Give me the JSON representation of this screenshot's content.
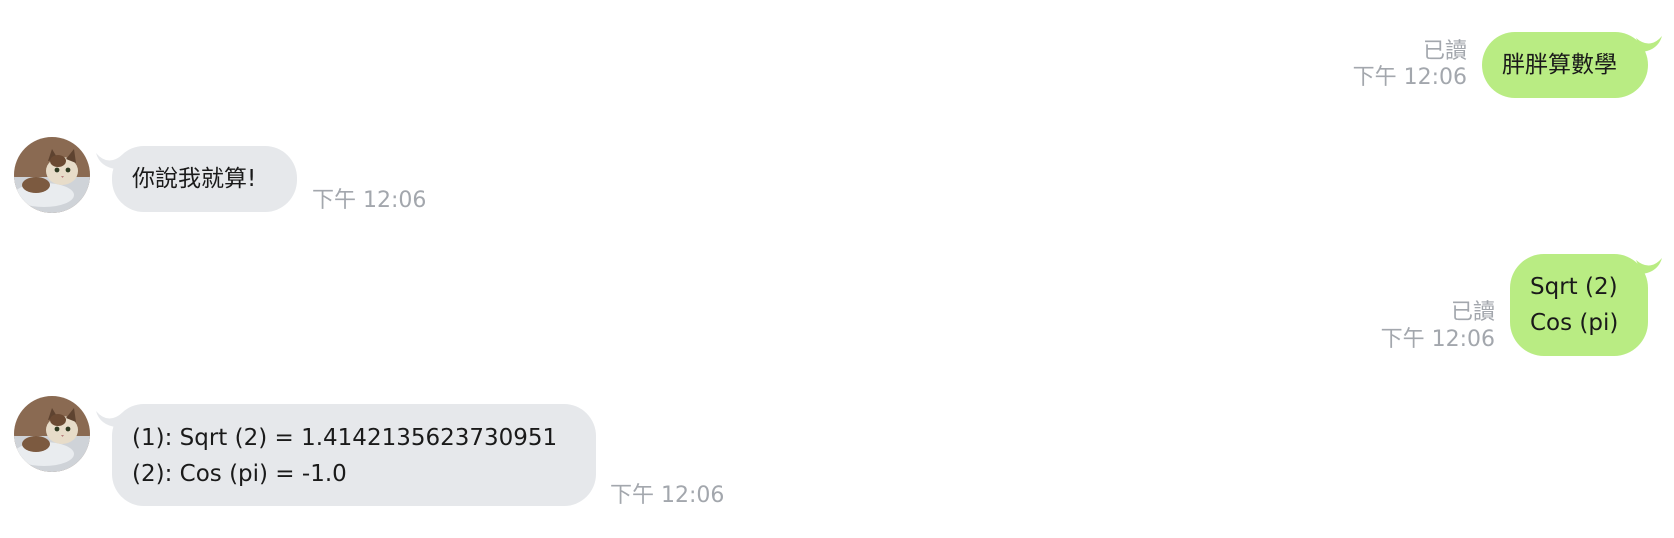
{
  "messages": [
    {
      "direction": "outgoing",
      "text": "胖胖算數學",
      "status": "已讀",
      "time": "下午 12:06"
    },
    {
      "direction": "incoming",
      "text": "你說我就算!",
      "time": "下午 12:06"
    },
    {
      "direction": "outgoing",
      "text": "Sqrt (2)\nCos (pi)",
      "status": "已讀",
      "time": "下午 12:06"
    },
    {
      "direction": "incoming",
      "text": "(1): Sqrt (2) = 1.4142135623730951\n(2): Cos (pi) = -1.0",
      "time": "下午 12:06"
    }
  ],
  "colors": {
    "outgoing_bubble": "#b9ec83",
    "incoming_bubble": "#e6e8eb",
    "meta_text": "#a3a7ad"
  },
  "icons": {
    "avatar": "cat-avatar-icon"
  }
}
